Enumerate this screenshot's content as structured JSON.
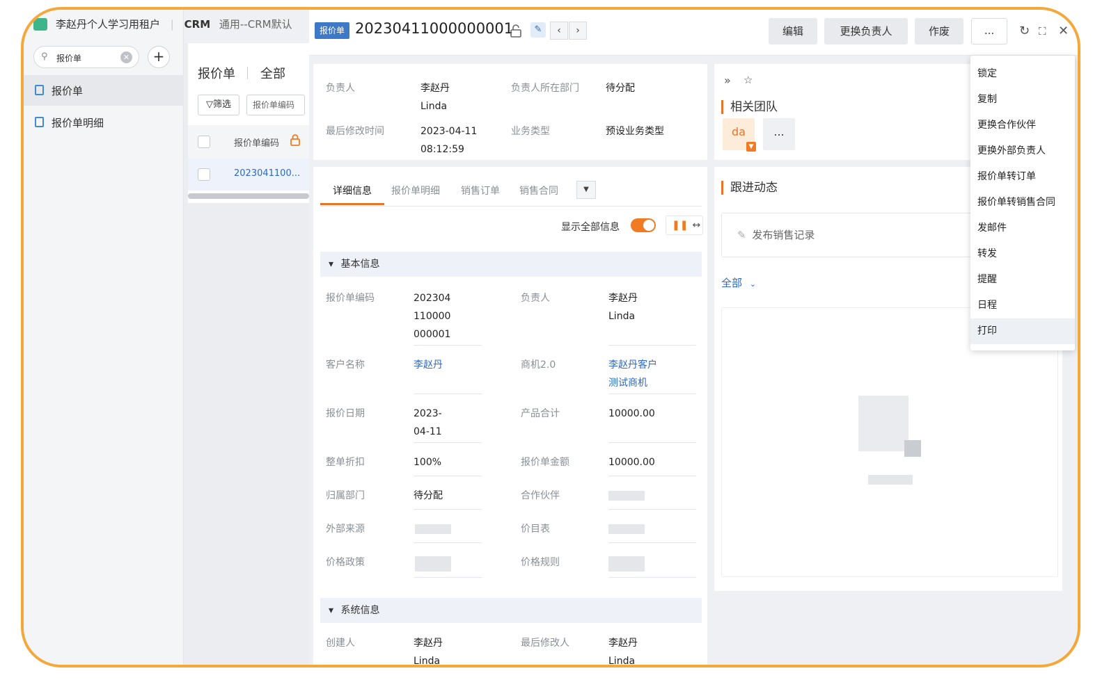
{
  "tenant_name": "李赵丹个人学习用租户",
  "app": {
    "name": "CRM",
    "subtitle": "通用--CRM默认"
  },
  "sidebar": {
    "search_value": "报价单",
    "items": [
      {
        "label": "报价单",
        "active": true
      },
      {
        "label": "报价单明细",
        "active": false
      }
    ]
  },
  "list": {
    "title": "报价单",
    "scope": "全部",
    "filter_label": "筛选",
    "search_placeholder": "报价单编码",
    "column_header": "报价单编码",
    "rows": [
      {
        "code": "2023041100..."
      }
    ]
  },
  "record": {
    "object_tag": "报价单",
    "number": "20230411000000001",
    "prev_icon": "chevron-left-icon",
    "next_icon": "chevron-right-icon"
  },
  "toolbar": {
    "edit_label": "编辑",
    "change_owner_label": "更换负责人",
    "void_label": "作废",
    "more_label": "..."
  },
  "summary": [
    {
      "label": "负责人",
      "value": "李赵丹\nLinda"
    },
    {
      "label": "负责人所在部门",
      "value": "待分配"
    },
    {
      "label": "最后修改时间",
      "value": "2023-04-11\n08:12:59"
    },
    {
      "label": "业务类型",
      "value": "预设业务类型"
    }
  ],
  "tabs": [
    {
      "label": "详细信息",
      "active": true
    },
    {
      "label": "报价单明细",
      "active": false
    },
    {
      "label": "销售订单",
      "active": false
    },
    {
      "label": "销售合同",
      "active": false
    }
  ],
  "show_all_label": "显示全部信息",
  "show_all_on": true,
  "sections": {
    "basic": {
      "title": "基本信息",
      "fields": [
        {
          "label": "报价单编码",
          "value": "202304\n110000\n000001"
        },
        {
          "label": "负责人",
          "value": "李赵丹\nLinda"
        },
        {
          "label": "客户名称",
          "value": "李赵丹",
          "link": true
        },
        {
          "label": "商机2.0",
          "value": "李赵丹客户\n测试商机",
          "link": true
        },
        {
          "label": "报价日期",
          "value": "2023-\n04-11"
        },
        {
          "label": "产品合计",
          "value": "10000.00"
        },
        {
          "label": "整单折扣",
          "value": "100%"
        },
        {
          "label": "报价单金额",
          "value": "10000.00"
        },
        {
          "label": "归属部门",
          "value": "待分配"
        },
        {
          "label": "合作伙伴",
          "value": ""
        },
        {
          "label": "外部来源",
          "value": ""
        },
        {
          "label": "价目表",
          "value": ""
        },
        {
          "label": "价格政策",
          "value": ""
        },
        {
          "label": "价格规则",
          "value": ""
        }
      ]
    },
    "system": {
      "title": "系统信息",
      "fields": [
        {
          "label": "创建人",
          "value": "李赵丹\nLinda"
        },
        {
          "label": "最后修改人",
          "value": "李赵丹\nLinda"
        }
      ]
    }
  },
  "team": {
    "title": "相关团队",
    "member_initials": "da",
    "more_label": "..."
  },
  "followup": {
    "title": "跟进动态",
    "publish_label": "发布销售记录",
    "filter_label": "全部"
  },
  "more_menu": [
    {
      "label": "锁定"
    },
    {
      "label": "复制"
    },
    {
      "label": "更换合作伙伴"
    },
    {
      "label": "更换外部负责人"
    },
    {
      "label": "报价单转订单"
    },
    {
      "label": "报价单转销售合同"
    },
    {
      "label": "发邮件"
    },
    {
      "label": "转发"
    },
    {
      "label": "提醒"
    },
    {
      "label": "日程"
    },
    {
      "label": "打印",
      "hover": true
    }
  ],
  "colors": {
    "accent": "#f07b22",
    "link": "#2a6ac9",
    "frame": "#f5a83a",
    "tag": "#3d79c7"
  }
}
